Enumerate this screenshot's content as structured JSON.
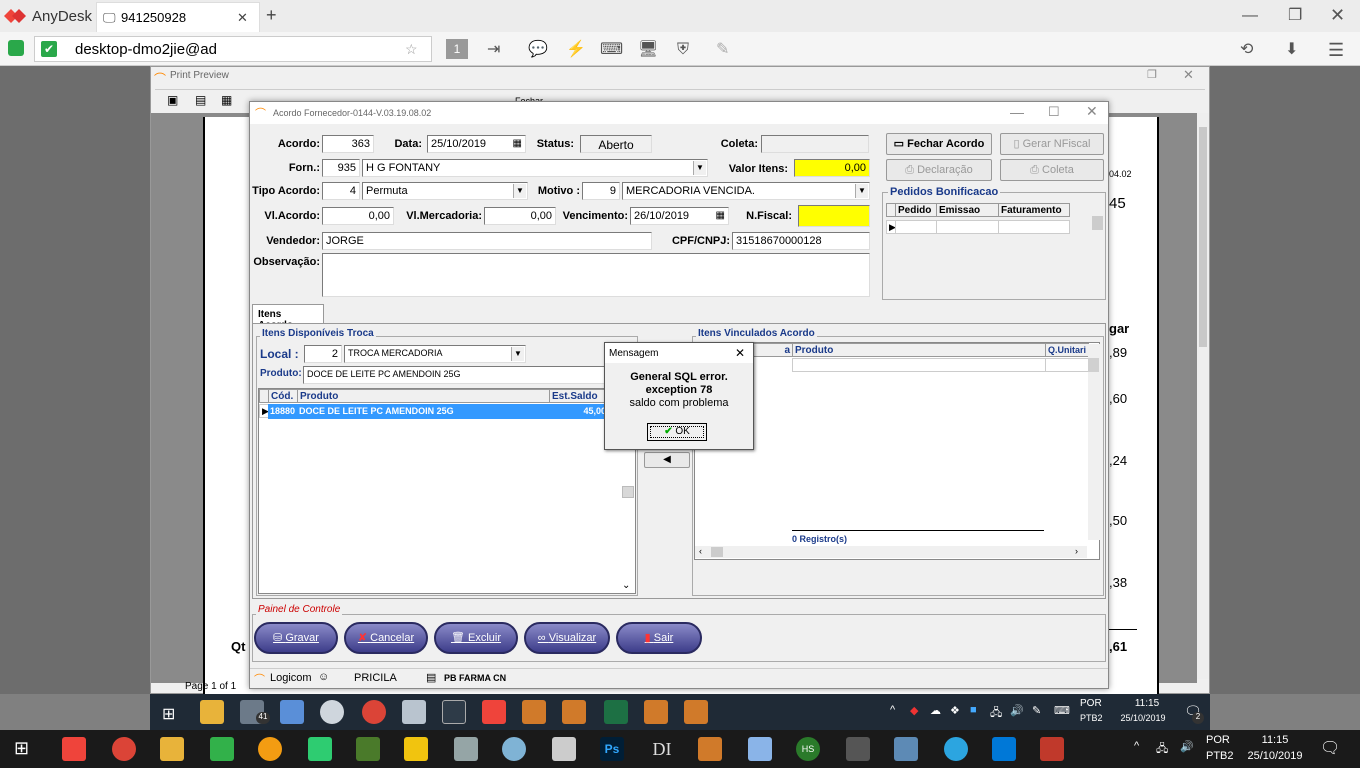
{
  "anydesk": {
    "app_name": "AnyDesk",
    "tab_id": "941250928",
    "tab_close": "✕",
    "new_tab": "+",
    "address": "desktop-dmo2jie@ad",
    "monitor_number": "1"
  },
  "print_preview": {
    "title": "Print Preview",
    "close_label": "Fechar",
    "page_status": "Page 1 of 1",
    "page_values": [
      "04.02",
      "45",
      "gar",
      ",89",
      ",60",
      ",24",
      ",50",
      ",38",
      ",61"
    ],
    "qty_label": "Qt"
  },
  "dialog": {
    "title": "Acordo Fornecedor-0144-V.03.19.08.02",
    "acordo_label": "Acordo:",
    "acordo_value": "363",
    "data_label": "Data:",
    "data_value": "25/10/2019",
    "status_label": "Status:",
    "status_value": "Aberto",
    "coleta_label": "Coleta:",
    "coleta_value": "",
    "forn_label": "Forn.:",
    "forn_code": "935",
    "forn_name": "H G FONTANY",
    "valor_itens_label": "Valor Itens:",
    "valor_itens_value": "0,00",
    "tipo_acordo_label": "Tipo Acordo:",
    "tipo_acordo_code": "4",
    "tipo_acordo_name": "Permuta",
    "motivo_label": "Motivo :",
    "motivo_code": "9",
    "motivo_name": "MERCADORIA VENCIDA.",
    "vl_acordo_label": "Vl.Acordo:",
    "vl_acordo_value": "0,00",
    "vl_mercadoria_label": "Vl.Mercadoria:",
    "vl_mercadoria_value": "0,00",
    "vencimento_label": "Vencimento:",
    "vencimento_value": "26/10/2019",
    "nfiscal_label": "N.Fiscal:",
    "nfiscal_value": "",
    "vendedor_label": "Vendedor:",
    "vendedor_value": "JORGE",
    "cpf_label": "CPF/CNPJ:",
    "cpf_value": "31518670000128",
    "observacao_label": "Observação:",
    "observacao_value": "",
    "btn_fechar_acordo": "Fechar Acordo",
    "btn_gerar_nfiscal": "Gerar NFiscal",
    "btn_declaracao": "Declaração",
    "btn_coleta": "Coleta",
    "pedidos_title": "Pedidos Bonificacao",
    "pedidos_cols": [
      "Pedido",
      "Emissao",
      "Faturamento"
    ],
    "tab_itens": "Itens Acordo",
    "disponiveis_title": "Itens Disponíveis Troca",
    "local_label": "Local :",
    "local_code": "2",
    "local_name": "TROCA MERCADORIA",
    "produto_label": "Produto:",
    "produto_value": "DOCE DE LEITE PC AMENDOIN 25G",
    "disp_cols": [
      "Cód.",
      "Produto",
      "Est.Saldo"
    ],
    "disp_row": {
      "cod": "18880",
      "produto": "DOCE DE LEITE PC AMENDOIN 25G",
      "saldo": "45,00"
    },
    "vinculados_title": "Itens Vinculados Acordo",
    "vinc_cols": [
      "a",
      "Produto",
      "Q.Unitari"
    ],
    "registros": "0  Registro(s)",
    "painel_title": "Painel de Controle",
    "btn_gravar": "Gravar",
    "btn_cancelar": "Cancelar",
    "btn_excluir": "Excluir",
    "btn_visualizar": "Visualizar",
    "btn_sair": "Sair",
    "status_app": "Logicom",
    "status_user": "PRICILA",
    "status_store": "PB FARMA CN"
  },
  "message": {
    "title": "Mensagem",
    "line1": "General SQL error.",
    "line2": "exception 78",
    "line3": "saldo com problema",
    "ok": "OK"
  },
  "remote_taskbar": {
    "lang": "POR",
    "layout": "PTB2",
    "time": "11:15",
    "date": "25/10/2019",
    "mail_badge": "41",
    "notif_badge": "2"
  },
  "local_taskbar": {
    "lang": "POR",
    "layout": "PTB2",
    "time": "11:15",
    "date": "25/10/2019",
    "ps_label": "Ps",
    "di_label": "DI",
    "hs_label": "HS"
  },
  "colors": {
    "yellow_field": "#ffff00",
    "selection": "#3399ff",
    "anydesk_red": "#ef443b"
  }
}
